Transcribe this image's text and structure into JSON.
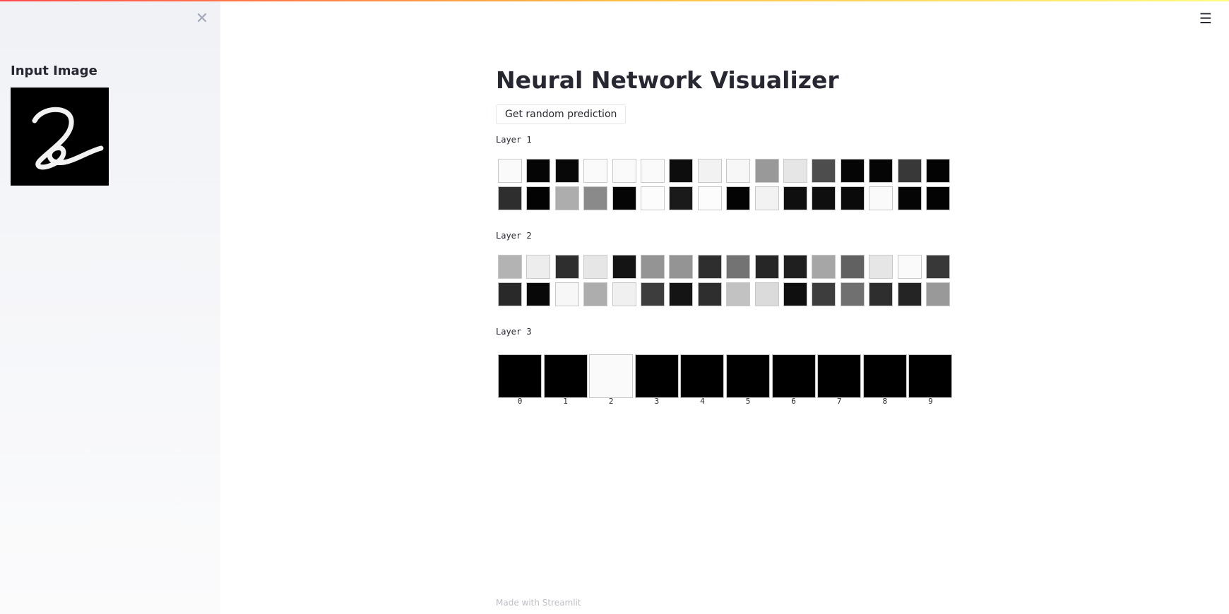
{
  "sidebar": {
    "close_icon": "close-icon",
    "title": "Input Image",
    "image_alt": "handwritten digit 2"
  },
  "header": {
    "menu_icon": "hamburger-menu-icon"
  },
  "main": {
    "title": "Neural Network Visualizer",
    "button_label": "Get random prediction"
  },
  "layers": [
    {
      "label": "Layer 1",
      "values": [
        [
          0.98,
          0.02,
          0.03,
          0.98,
          0.98,
          0.98,
          0.05,
          0.95,
          0.97,
          0.6,
          0.9,
          0.3,
          0.02,
          0.02,
          0.22,
          0.01
        ],
        [
          0.18,
          0.01,
          0.68,
          0.54,
          0.02,
          0.99,
          0.1,
          0.99,
          0.01,
          0.95,
          0.06,
          0.06,
          0.04,
          0.98,
          0.02,
          0.01
        ]
      ]
    },
    {
      "label": "Layer 2",
      "values": [
        [
          0.7,
          0.93,
          0.18,
          0.9,
          0.08,
          0.58,
          0.58,
          0.18,
          0.45,
          0.15,
          0.12,
          0.65,
          0.38,
          0.9,
          0.98,
          0.22
        ],
        [
          0.16,
          0.03,
          0.97,
          0.68,
          0.94,
          0.24,
          0.08,
          0.18,
          0.76,
          0.86,
          0.06,
          0.24,
          0.44,
          0.18,
          0.14,
          0.6
        ]
      ]
    },
    {
      "label": "Layer 3",
      "values": [
        0.0,
        0.0,
        0.98,
        0.0,
        0.0,
        0.0,
        0.0,
        0.0,
        0.0,
        0.0
      ],
      "ticks": [
        "0",
        "1",
        "2",
        "3",
        "4",
        "5",
        "6",
        "7",
        "8",
        "9"
      ]
    }
  ],
  "footer": {
    "text": "Made with Streamlit"
  }
}
